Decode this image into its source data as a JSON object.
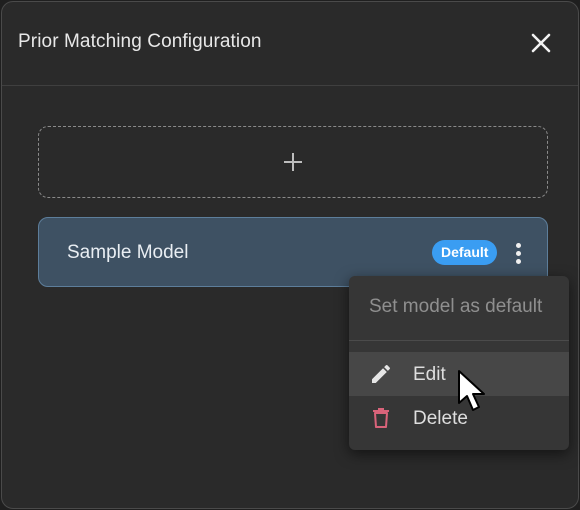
{
  "dialog": {
    "title": "Prior Matching Configuration",
    "close_icon": "close-icon"
  },
  "add_card": {
    "icon": "plus-icon"
  },
  "model": {
    "name": "Sample Model",
    "badge": "Default",
    "menu_icon": "more-vertical-icon"
  },
  "context_menu": {
    "set_default_label": "Set model as default",
    "edit_label": "Edit",
    "edit_icon": "pencil-icon",
    "delete_label": "Delete",
    "delete_icon": "trash-icon"
  },
  "colors": {
    "background": "#2a2a2a",
    "card_selected": "#3e5163",
    "badge": "#3a9df2",
    "delete_icon": "#d9637a"
  }
}
